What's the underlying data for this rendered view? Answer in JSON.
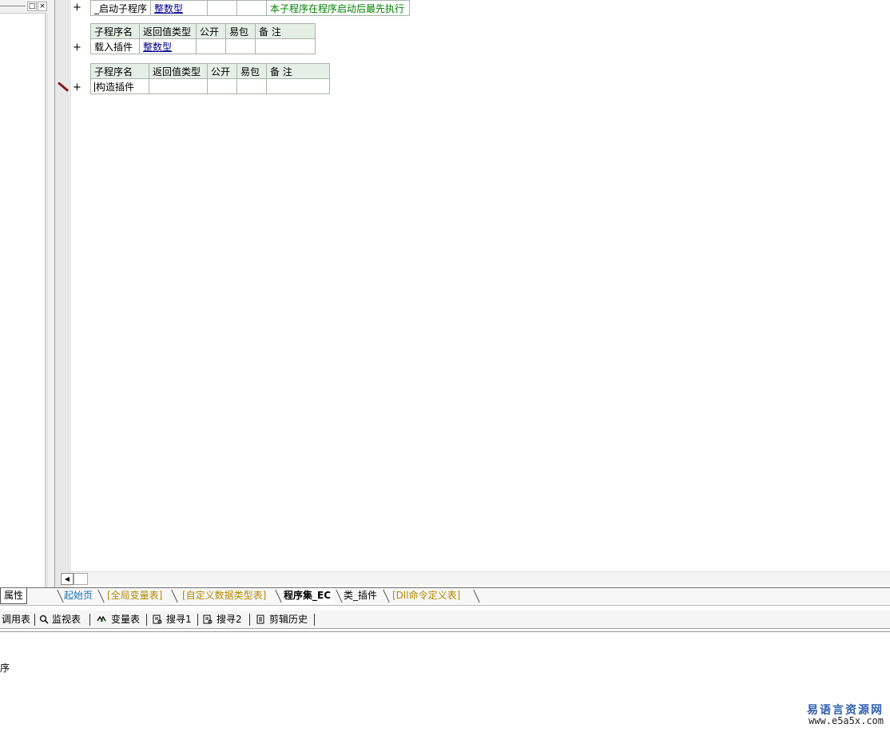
{
  "left_panel": {
    "pin_btn": "□",
    "close_btn": "×",
    "bottom_tab": "属性"
  },
  "tables": [
    {
      "header": [],
      "row": [
        "_启动子程序",
        "整数型",
        "",
        "",
        "本子程序在程序启动后最先执行"
      ]
    },
    {
      "header": [
        "子程序名",
        "返回值类型",
        "公开",
        "易包",
        "备 注"
      ],
      "row": [
        "载入插件",
        "整数型",
        "",
        "",
        ""
      ]
    },
    {
      "header": [
        "子程序名",
        "返回值类型",
        "公开",
        "易包",
        "备 注"
      ],
      "row": [
        "构造插件",
        "",
        "",
        "",
        ""
      ]
    }
  ],
  "plus_sign": "+",
  "editor_tabs": [
    {
      "label": "起始页",
      "color": "#1a6fb0",
      "active": false
    },
    {
      "label": "[全局变量表]",
      "color": "#b08a00",
      "active": false
    },
    {
      "label": "[自定义数据类型表]",
      "color": "#b08a00",
      "active": false
    },
    {
      "label": "程序集_EC",
      "color": "#000000",
      "active": true
    },
    {
      "label": "类_插件",
      "color": "#000000",
      "active": false
    },
    {
      "label": "[Dll命令定义表]",
      "color": "#b08a00",
      "active": false
    }
  ],
  "tool_tabs": [
    {
      "label": "调用表",
      "icon": "table-icon"
    },
    {
      "label": "监视表",
      "icon": "magnifier-icon"
    },
    {
      "label": "变量表",
      "icon": "variables-icon"
    },
    {
      "label": "搜寻1",
      "icon": "search-doc-icon"
    },
    {
      "label": "搜寻2",
      "icon": "search-doc-icon"
    },
    {
      "label": "剪辑历史",
      "icon": "clipboard-icon"
    }
  ],
  "output_text": "序",
  "watermark": {
    "title": "易语言资源网",
    "url": "www.e5a5x.com"
  }
}
